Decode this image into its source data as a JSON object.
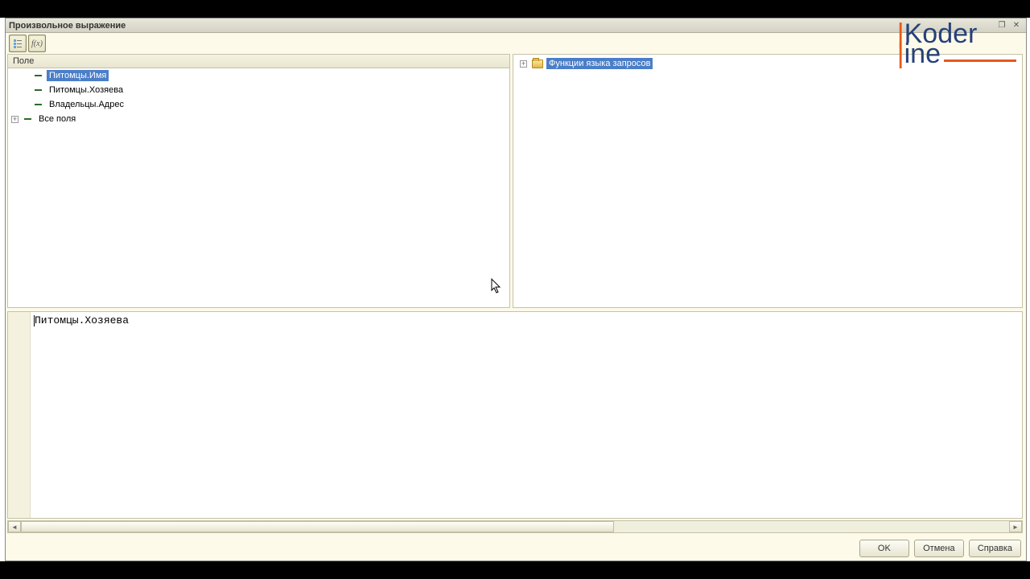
{
  "window": {
    "title": "Произвольное выражение"
  },
  "toolbar": {
    "btn_list_tooltip": "Показать список полей",
    "btn_fx_label": "f(x)"
  },
  "left_panel": {
    "header": "Поле",
    "items": [
      {
        "label": "Питомцы.Имя",
        "selected": true
      },
      {
        "label": "Питомцы.Хозяева",
        "selected": false
      },
      {
        "label": "Владельцы.Адрес",
        "selected": false
      },
      {
        "label": "Все поля",
        "selected": false,
        "expandable": true
      }
    ]
  },
  "right_panel": {
    "items": [
      {
        "label": "Функции языка запросов",
        "selected": true,
        "expandable": true
      }
    ]
  },
  "editor": {
    "text": "Питомцы.Хозяева"
  },
  "buttons": {
    "ok": "OK",
    "cancel": "Отмена",
    "help": "Справка"
  },
  "logo": {
    "line1_pre": "|",
    "line1": "Koder",
    "line2_pre": "|",
    "line2": "ine"
  }
}
